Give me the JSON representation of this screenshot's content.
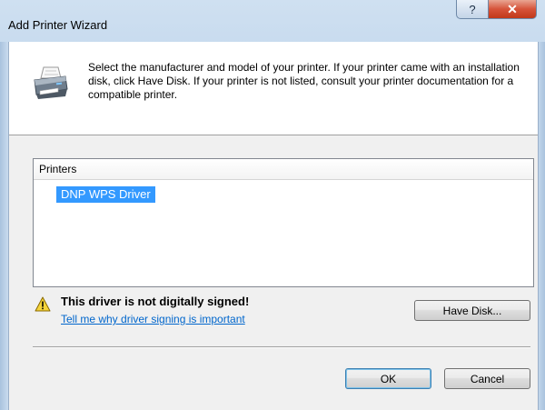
{
  "window": {
    "title": "Add Printer Wizard",
    "help_glyph": "?",
    "close_glyph": "✕"
  },
  "header": {
    "instructions": "Select the manufacturer and model of your printer. If your printer came with an installation disk, click Have Disk. If your printer is not listed, consult your printer documentation for a compatible printer."
  },
  "printers_list": {
    "column_header": "Printers",
    "items": [
      "DNP WPS Driver"
    ],
    "selected_index": 0
  },
  "warning": {
    "title": "This driver is not digitally signed!",
    "link": "Tell me why driver signing is important"
  },
  "buttons": {
    "have_disk": "Have Disk...",
    "ok": "OK",
    "cancel": "Cancel"
  },
  "colors": {
    "selection": "#3399ff",
    "link": "#0066cc",
    "close": "#c13819"
  },
  "icons": {
    "header": "printer-icon",
    "warning": "warning-icon"
  }
}
